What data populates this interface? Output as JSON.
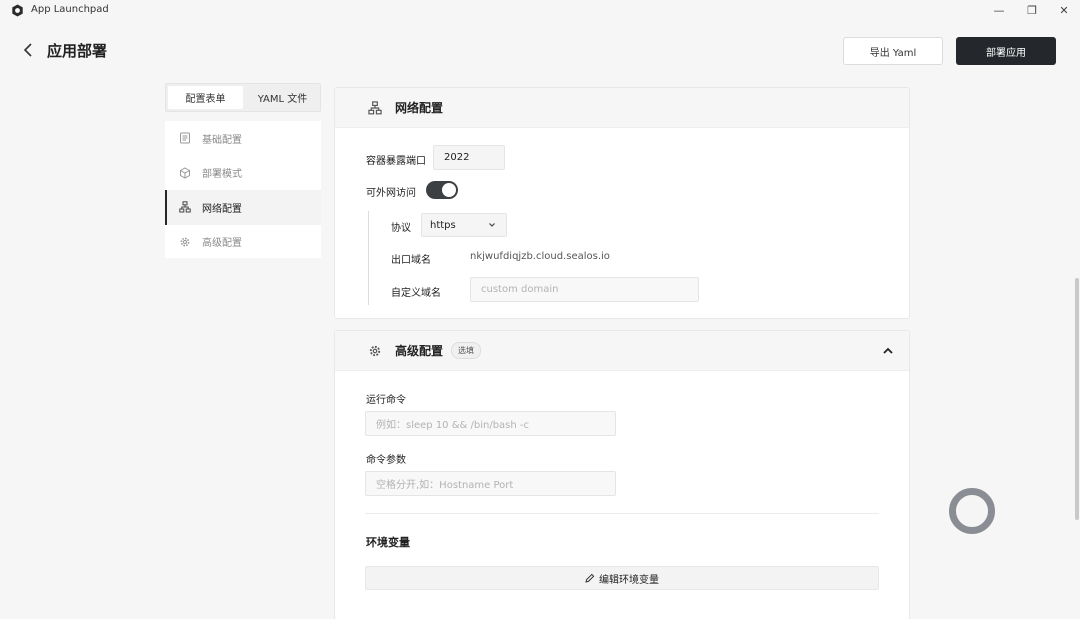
{
  "app": {
    "title": "App Launchpad"
  },
  "window": {
    "minimize": "—",
    "restore": "❐",
    "close": "✕"
  },
  "header": {
    "title": "应用部署",
    "export_label": "导出 Yaml",
    "deploy_label": "部署应用"
  },
  "tabs": [
    {
      "label": "配置表单",
      "active": true
    },
    {
      "label": "YAML 文件",
      "active": false
    }
  ],
  "nav": [
    {
      "label": "基础配置",
      "icon": "document-icon",
      "active": false
    },
    {
      "label": "部署模式",
      "icon": "cube-icon",
      "active": false
    },
    {
      "label": "网络配置",
      "icon": "network-icon",
      "active": true
    },
    {
      "label": "高级配置",
      "icon": "gear-icon",
      "active": false
    }
  ],
  "network": {
    "title": "网络配置",
    "port_label": "容器暴露端口",
    "port_value": "2022",
    "public_label": "可外网访问",
    "public_enabled": true,
    "protocol_label": "协议",
    "protocol_value": "https",
    "domain_label": "出口域名",
    "domain_value": "nkjwufdiqjzb.cloud.sealos.io",
    "custom_domain_label": "自定义域名",
    "custom_domain_placeholder": "custom domain"
  },
  "advanced": {
    "title": "高级配置",
    "badge": "选填",
    "cmd_label": "运行命令",
    "cmd_placeholder": "例如：sleep 10 && /bin/bash -c",
    "args_label": "命令参数",
    "args_placeholder": "空格分开,如：Hostname Port",
    "env_title": "环境变量",
    "env_button": "编辑环境变量"
  },
  "colors": {
    "accent": "#24282c",
    "background": "#f6f6f6",
    "card": "#ffffff"
  }
}
